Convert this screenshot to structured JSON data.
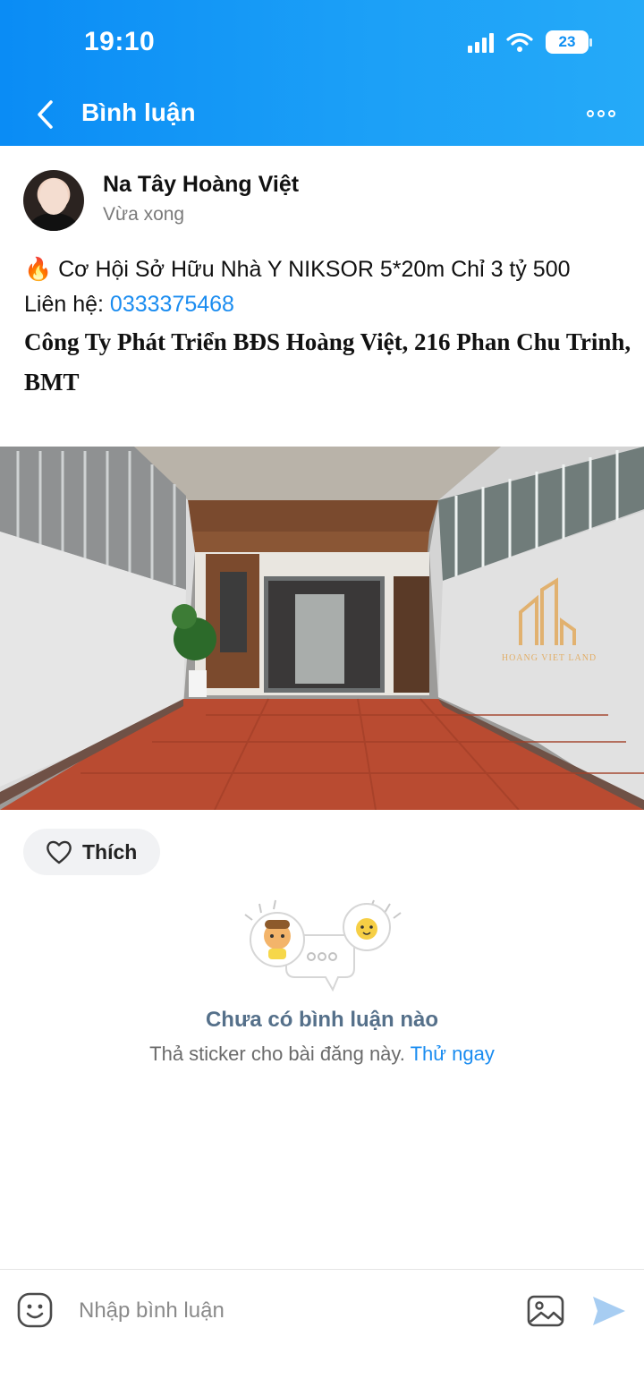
{
  "status_bar": {
    "time": "19:10",
    "battery": "23"
  },
  "header": {
    "title": "Bình luận"
  },
  "post": {
    "author": "Na Tây Hoàng Việt",
    "time": "Vừa xong",
    "headline": "🔥 Cơ Hội Sở Hữu Nhà Y NIKSOR 5*20m Chỉ 3 tỷ 500",
    "contact_label": "Liên hệ: ",
    "phone": "0333375468",
    "company": "Công Ty Phát Triển BĐS Hoàng Việt, 216 Phan Chu Trinh, BMT",
    "watermark": "HOANG VIET LAND"
  },
  "like": {
    "label": "Thích"
  },
  "comments": {
    "empty_title": "Chưa có bình luận nào",
    "empty_sub": "Thả sticker cho bài đăng này. ",
    "empty_link": "Thử ngay"
  },
  "composer": {
    "placeholder": "Nhập bình luận"
  },
  "colors": {
    "accent": "#1a8cf0",
    "header_start": "#0a8cf5",
    "header_end": "#25aaf8"
  }
}
